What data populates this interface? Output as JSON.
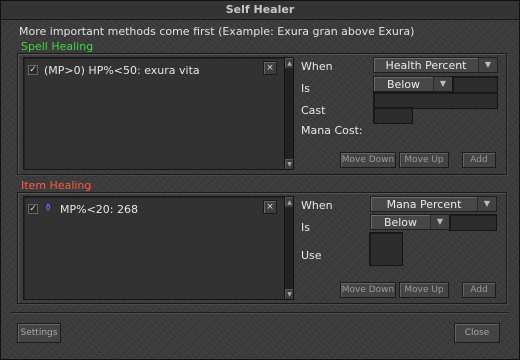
{
  "window": {
    "title": "Self Healer"
  },
  "info_text": "More important methods come first (Example: Exura gran above Exura)",
  "spell": {
    "section_label": "Spell Healing",
    "entries": [
      {
        "text": "(MP>0) HP%<50: exura vita",
        "checked": true
      }
    ],
    "remove_symbol": "×",
    "when_label": "When",
    "when_value": "Health Percent",
    "is_label": "Is",
    "is_value": "Below",
    "cast_label": "Cast",
    "mana_cost_label": "Mana Cost:",
    "buttons": {
      "move_down": "Move Down",
      "move_up": "Move Up",
      "add": "Add"
    }
  },
  "item": {
    "section_label": "Item Healing",
    "entries": [
      {
        "text": "MP%<20: 268",
        "checked": true,
        "icon": "potion-icon"
      }
    ],
    "remove_symbol": "×",
    "when_label": "When",
    "when_value": "Mana Percent",
    "is_label": "Is",
    "is_value": "Below",
    "use_label": "Use",
    "buttons": {
      "move_down": "Move Down",
      "move_up": "Move Up",
      "add": "Add"
    }
  },
  "footer": {
    "settings": "Settings",
    "close": "Close"
  },
  "colors": {
    "spell_label": "#41d641",
    "item_label": "#ff5b3c",
    "potion": "#b44cff"
  }
}
